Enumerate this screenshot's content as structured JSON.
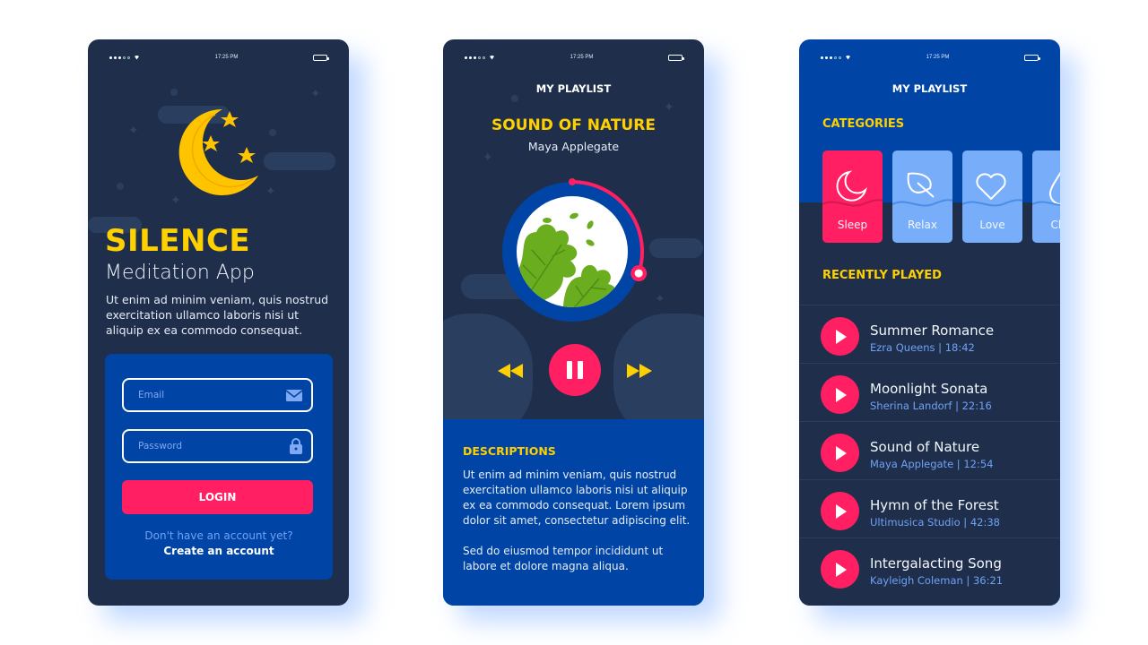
{
  "status_bar": {
    "time": "17:25 PM"
  },
  "login_screen": {
    "brand": "SILENCE",
    "subtitle": "Meditation App",
    "intro": "Ut enim ad minim veniam, quis nostrud exercitation ullamco laboris nisi ut aliquip ex ea commodo consequat.",
    "email": {
      "placeholder": "Email",
      "value": "",
      "icon": "envelope-icon"
    },
    "password": {
      "placeholder": "Password",
      "value": "",
      "icon": "lock-icon"
    },
    "login_label": "LOGIN",
    "no_account_text": "Don't have an account yet?",
    "create_account_label": "Create an account"
  },
  "player_screen": {
    "title": "MY PLAYLIST",
    "song_title": "SOUND OF NATURE",
    "artist": "Maya Applegate",
    "progress": 0.3,
    "controls": {
      "prev": "rewind-icon",
      "play": "pause-icon",
      "next": "fast-forward-icon"
    },
    "description_heading": "DESCRIPTIONS",
    "description_p1": "Ut enim ad minim veniam, quis nostrud exercitation ullamco laboris nisi ut aliquip ex ea commodo consequat. Lorem ipsum dolor sit amet, consectetur adipiscing elit.",
    "description_p2": "Sed do eiusmod tempor incididunt ut labore et dolore magna aliqua."
  },
  "playlist_screen": {
    "title": "MY PLAYLIST",
    "categories_heading": "CATEGORIES",
    "categories": [
      {
        "label": "Sleep",
        "icon": "moon-icon",
        "active": true
      },
      {
        "label": "Relax",
        "icon": "leaf-icon",
        "active": false
      },
      {
        "label": "Love",
        "icon": "heart-icon",
        "active": false
      },
      {
        "label": "Chill",
        "icon": "drop-icon",
        "active": false
      }
    ],
    "recent_heading": "RECENTLY PLAYED",
    "tracks": [
      {
        "title": "Summer Romance",
        "meta": "Ezra Queens | 18:42"
      },
      {
        "title": "Moonlight Sonata",
        "meta": "Sherina Landorf | 22:16"
      },
      {
        "title": "Sound of Nature",
        "meta": "Maya Applegate | 12:54"
      },
      {
        "title": "Hymn of the Forest",
        "meta": "Ultimusica Studio | 42:38"
      },
      {
        "title": "Intergalacting Song",
        "meta": "Kayleigh Coleman | 36:21"
      }
    ]
  },
  "colors": {
    "navy": "#1f2f4b",
    "blue": "#0045a6",
    "accent_pink": "#ff1f62",
    "accent_yellow": "#ffd000",
    "light_blue": "#78aef9"
  }
}
